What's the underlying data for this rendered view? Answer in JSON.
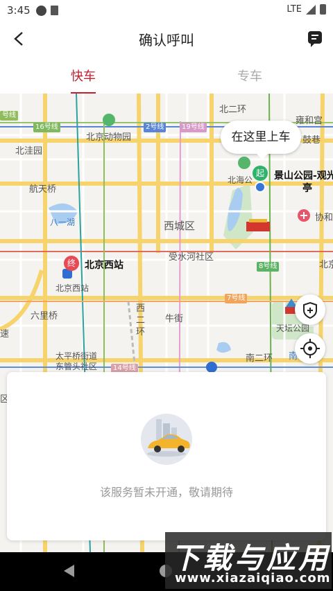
{
  "status_bar": {
    "time": "3:45",
    "network": "LTE"
  },
  "header": {
    "title": "确认呼叫"
  },
  "tabs": [
    {
      "label": "快车"
    },
    {
      "label": "专车"
    }
  ],
  "map": {
    "labels": {
      "ring2_north": "北二环",
      "yonghegong": "雍和宫",
      "gulou": "鼓巷",
      "zoo": "北京动物园",
      "line16": "16号线",
      "line2": "2号线",
      "line19": "19号线",
      "line9_partial": "号线",
      "beiwayuan": "北洼园",
      "beihai": "北海公",
      "jingshan": "景山公园-观光",
      "jingshan_2": "亭",
      "hangtianqiao": "航天桥",
      "bayi_lake": "八一湖",
      "xicheng": "西城区",
      "xiehe": "协和",
      "shoushuihe": "受水河社区",
      "line8": "8号线",
      "bei_right": "北京",
      "beijingxi_pin": "北京西站",
      "beijingxi_station": "北京西站",
      "line7": "7号线",
      "liuliqiao": "六里桥",
      "xierhuan_1": "西",
      "xierhuan_2": "二",
      "xierhuan_3": "环",
      "niujie": "牛街",
      "tiantan": "天坛公园",
      "taiping_1": "太平桥街道",
      "taiping_2": "东管头社区",
      "line14": "14号线",
      "ring2_south": "南二环",
      "nan": "南",
      "su": "速",
      "qu": "区"
    },
    "pickup_bubble": "在这里上车",
    "start_pin": "起",
    "end_pin": "终"
  },
  "service_panel": {
    "message": "该服务暂未开通，敬请期待"
  },
  "watermark": {
    "title": "下载与应用",
    "url": "www.xiazaiqiao.com"
  },
  "colors": {
    "accent": "#c0202f",
    "start_pin": "#2fb36a",
    "end_pin": "#e84a55",
    "location": "#3477d8"
  },
  "icons": {
    "back": "arrow-left-icon",
    "message": "message-icon",
    "shield": "shield-plus-icon",
    "locate": "crosshair-icon",
    "nav_back": "triangle-back-icon",
    "nav_home": "circle-home-icon"
  }
}
